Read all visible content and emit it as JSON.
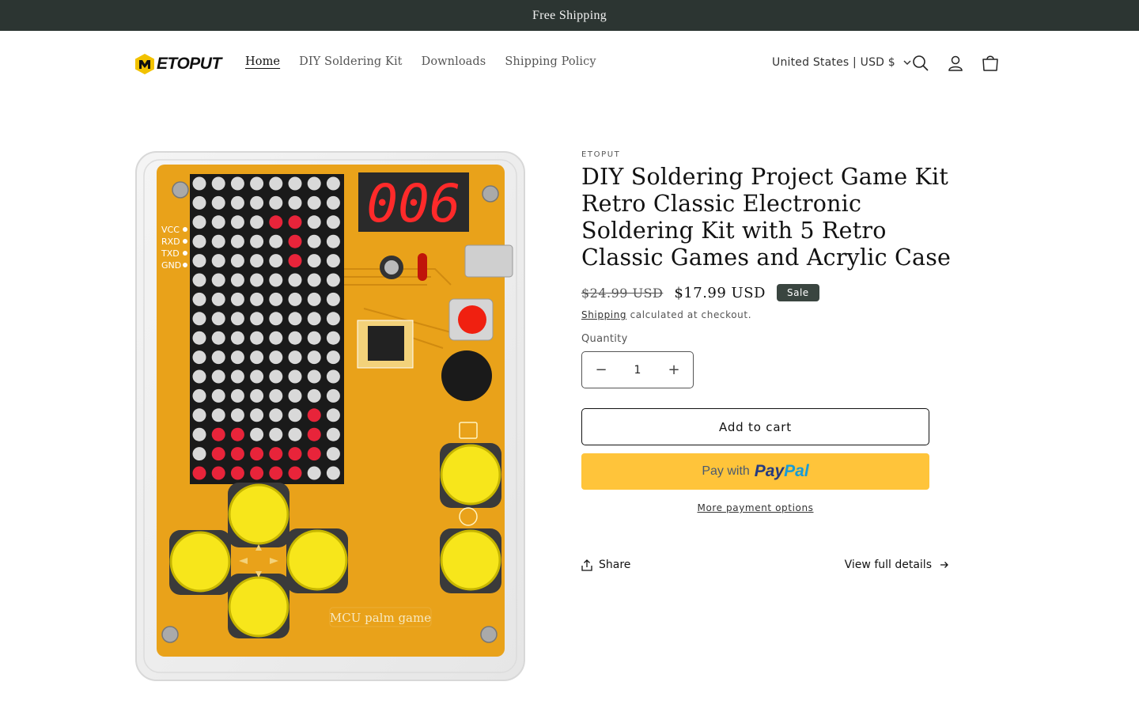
{
  "announcement": {
    "text": "Free Shipping"
  },
  "header": {
    "logo_text": "ETOPUT",
    "nav": [
      {
        "label": "Home",
        "active": true
      },
      {
        "label": "DIY Soldering Kit",
        "active": false
      },
      {
        "label": "Downloads",
        "active": false
      },
      {
        "label": "Shipping Policy",
        "active": false
      }
    ],
    "country_selector": "United States | USD $",
    "icons": [
      "search-icon",
      "account-icon",
      "cart-icon"
    ]
  },
  "product": {
    "vendor": "ETOPUT",
    "title": "DIY Soldering Project Game Kit Retro Classic Electronic Soldering Kit with 5 Retro Classic Games and Acrylic Case",
    "price_regular": "$24.99 USD",
    "price_sale": "$17.99 USD",
    "badge": "Sale",
    "shipping_link": "Shipping",
    "shipping_note": " calculated at checkout.",
    "quantity_label": "Quantity",
    "quantity_value": "1",
    "add_to_cart": "Add to cart",
    "paypal_prefix": "Pay with",
    "more_payment": "More payment options",
    "share": "Share",
    "view_details": "View full details",
    "image": {
      "display": "006",
      "pin_labels": [
        "VCC",
        "RXD",
        "TXD",
        "GND"
      ],
      "board_text": "MCU palm game"
    }
  },
  "colors": {
    "announcement_bg": "#2c3532",
    "badge_bg": "#3a4540",
    "paypal_bg": "#ffc43a",
    "pcb": "#e9a21a",
    "led_red": "#e8243a"
  }
}
